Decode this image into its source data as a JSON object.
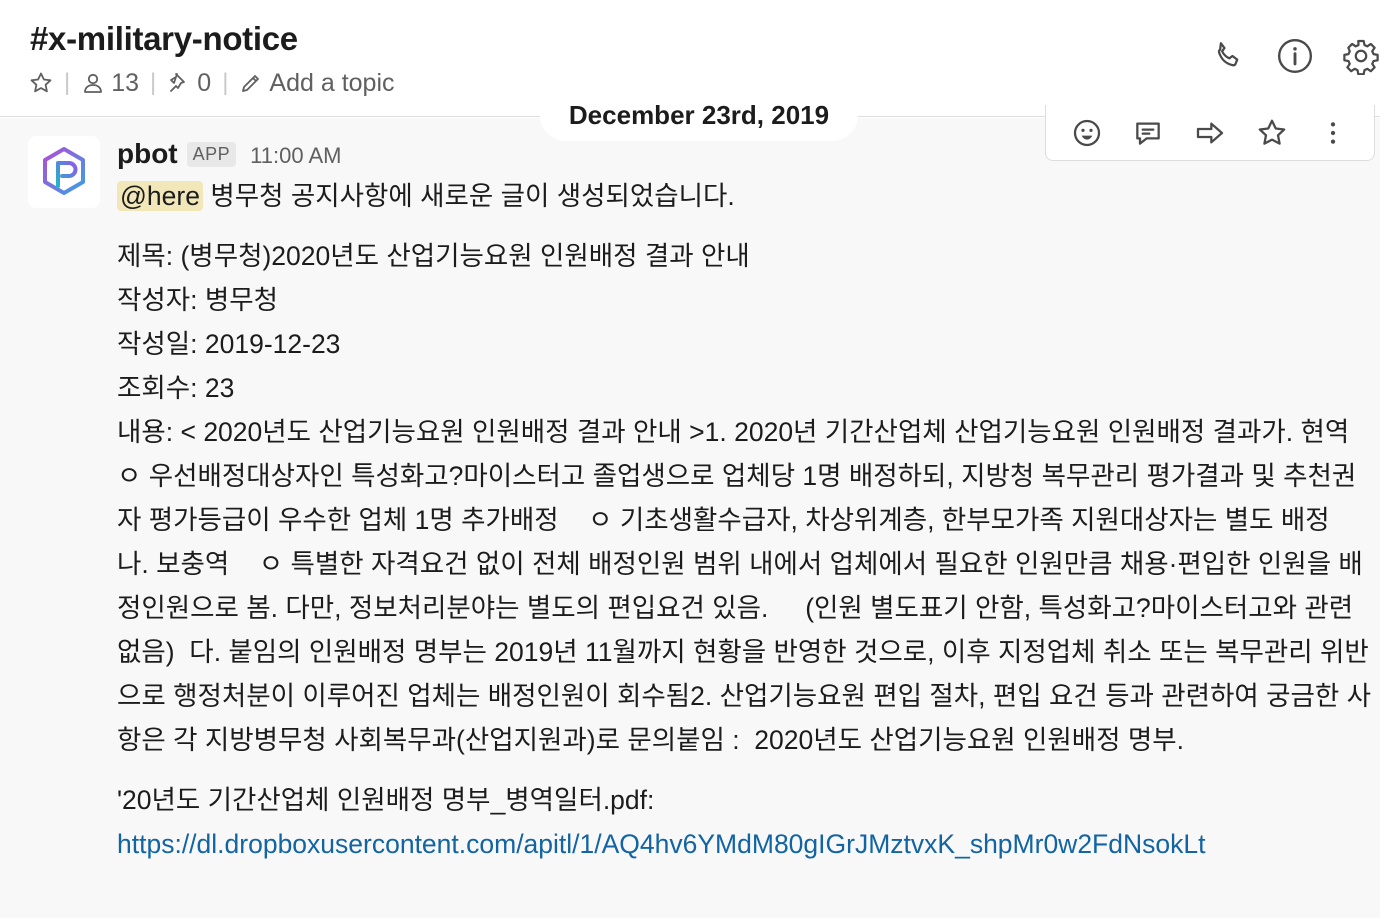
{
  "header": {
    "channel_name": "#x-military-notice",
    "member_count": "13",
    "pinned_count": "0",
    "topic_placeholder": "Add a topic"
  },
  "date_divider": "December 23rd, 2019",
  "message": {
    "sender": "pbot",
    "badge": "APP",
    "time": "11:00 AM",
    "mention": "@here",
    "intro": " 병무청 공지사항에 새로운 글이 생성되었습니다.",
    "fields": [
      "제목: (병무청)2020년도 산업기능요원 인원배정 결과 안내",
      "작성자: 병무청",
      "작성일: 2019-12-23",
      "조회수: 23"
    ],
    "content": "내용: < 2020년도 산업기능요원 인원배정 결과 안내 >1. 2020년 기간산업체 산업기능요원 인원배정 결과가. 현역    ㅇ 우선배정대상자인 특성화고?마이스터고 졸업생으로 업체당 1명 배정하되, 지방청 복무관리 평가결과 및 추천권자 평가등급이 우수한 업체 1명 추가배정    ㅇ 기초생활수급자, 차상위계층, 한부모가족 지원대상자는 별도 배정  나. 보충역    ㅇ 특별한 자격요건 없이 전체 배정인원 범위 내에서 업체에서 필요한 인원만큼 채용·편입한 인원을 배정인원으로 봄. 다만, 정보처리분야는 별도의 편입요건 있음.     (인원 별도표기 안함, 특성화고?마이스터고와 관련 없음)  다. 붙임의 인원배정 명부는 2019년 11월까지 현황을 반영한 것으로, 이후 지정업체 취소 또는 복무관리 위반으로 행정처분이 이루어진 업체는 배정인원이 회수됨2. 산업기능요원 편입 절차, 편입 요건 등과 관련하여 궁금한 사항은 각 지방병무청 사회복무과(산업지원과)로 문의붙임 :  2020년도 산업기능요원 인원배정 명부.",
    "attachment_label": "'20년도 기간산업체 인원배정 명부_병역일터.pdf:",
    "attachment_link": "https://dl.dropboxusercontent.com/apitl/1/AQ4hv6YMdM80gIGrJMztvxK_shpMr0w2FdNsokLt"
  },
  "icons": {
    "header": [
      "phone-icon",
      "info-icon",
      "gear-icon"
    ],
    "actions": [
      "add-reaction-icon",
      "reply-thread-icon",
      "share-message-icon",
      "save-star-icon",
      "more-actions-icon"
    ]
  },
  "colors": {
    "mention_bg": "#f2e7b9",
    "link": "#1264a3",
    "hover_bg": "#f8f8f8"
  }
}
